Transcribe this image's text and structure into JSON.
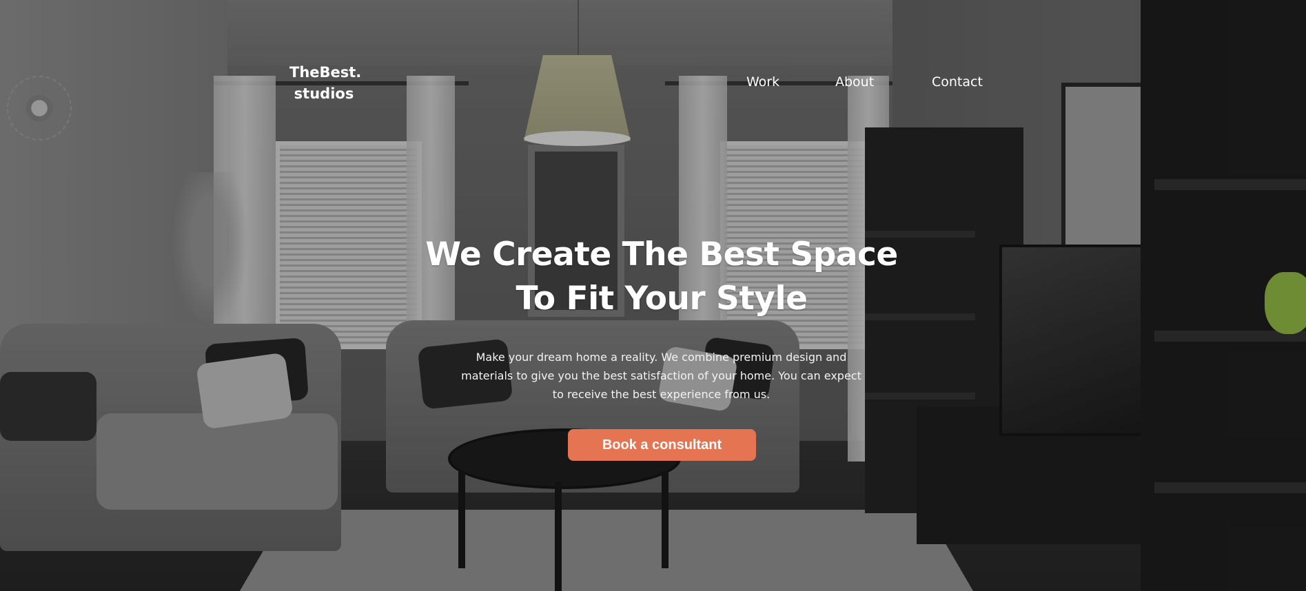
{
  "brand": {
    "line1": "TheBest.",
    "line2": "studios"
  },
  "nav": {
    "items": [
      {
        "label": "Work"
      },
      {
        "label": "About"
      },
      {
        "label": "Contact"
      }
    ]
  },
  "hero": {
    "title_line1": "We Create The Best Space",
    "title_line2": "To Fit Your Style",
    "subtitle": "Make your dream home a reality. We combine premium design and materials to give you the best satisfaction of your home. You can expect to receive the best experience from us.",
    "cta_label": "Book a consultant"
  },
  "colors": {
    "accent": "#e47452",
    "text": "#ffffff"
  }
}
